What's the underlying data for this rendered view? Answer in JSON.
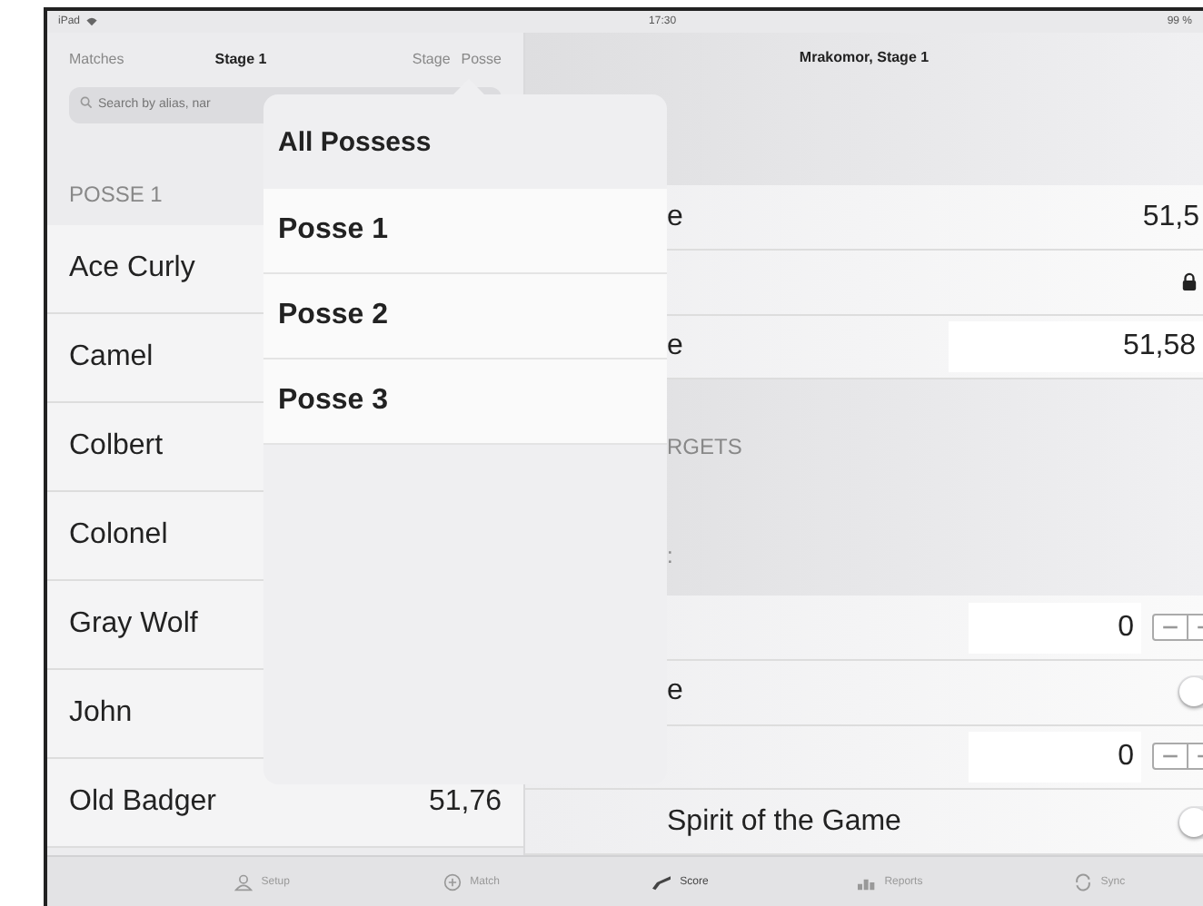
{
  "status_bar": {
    "device": "iPad",
    "time": "17:30",
    "battery": "99 %"
  },
  "master": {
    "back": "Matches",
    "title": "Stage 1",
    "segments": [
      {
        "label": "Stage"
      },
      {
        "label": "Posse"
      }
    ],
    "search": {
      "placeholder": "Search by alias, nar"
    },
    "section": "POSSE 1",
    "rows": [
      {
        "name": "Ace Curly"
      },
      {
        "name": "Camel"
      },
      {
        "name": "Colbert"
      },
      {
        "name": "Colonel"
      },
      {
        "name": "Gray Wolf"
      },
      {
        "name": "John"
      },
      {
        "name": "Old Badger",
        "score": "51,76"
      }
    ]
  },
  "popover": {
    "title": "All Possess",
    "items": [
      {
        "label": "Posse 1"
      },
      {
        "label": "Posse 2"
      },
      {
        "label": "Posse 3"
      }
    ]
  },
  "detail": {
    "title": "Mrakomor, Stage 1",
    "group_1": [
      {
        "kind": "value",
        "label": "e",
        "value": "51,5"
      },
      {
        "kind": "lock"
      },
      {
        "kind": "field",
        "label": "e",
        "value": "51,58"
      }
    ],
    "header": "RGETS",
    "subheader": ":",
    "group_2": [
      {
        "kind": "stepper",
        "value": "0"
      },
      {
        "kind": "toggle",
        "label": "e",
        "on": false
      },
      {
        "kind": "stepper",
        "value": "0"
      },
      {
        "kind": "toggle",
        "label": "Spirit of the Game",
        "on": false
      }
    ]
  },
  "tabs": [
    {
      "label": "Setup",
      "selected": false
    },
    {
      "label": "Match",
      "selected": false
    },
    {
      "label": "Score",
      "selected": true
    },
    {
      "label": "Reports",
      "selected": false
    },
    {
      "label": "Sync",
      "selected": false
    }
  ]
}
